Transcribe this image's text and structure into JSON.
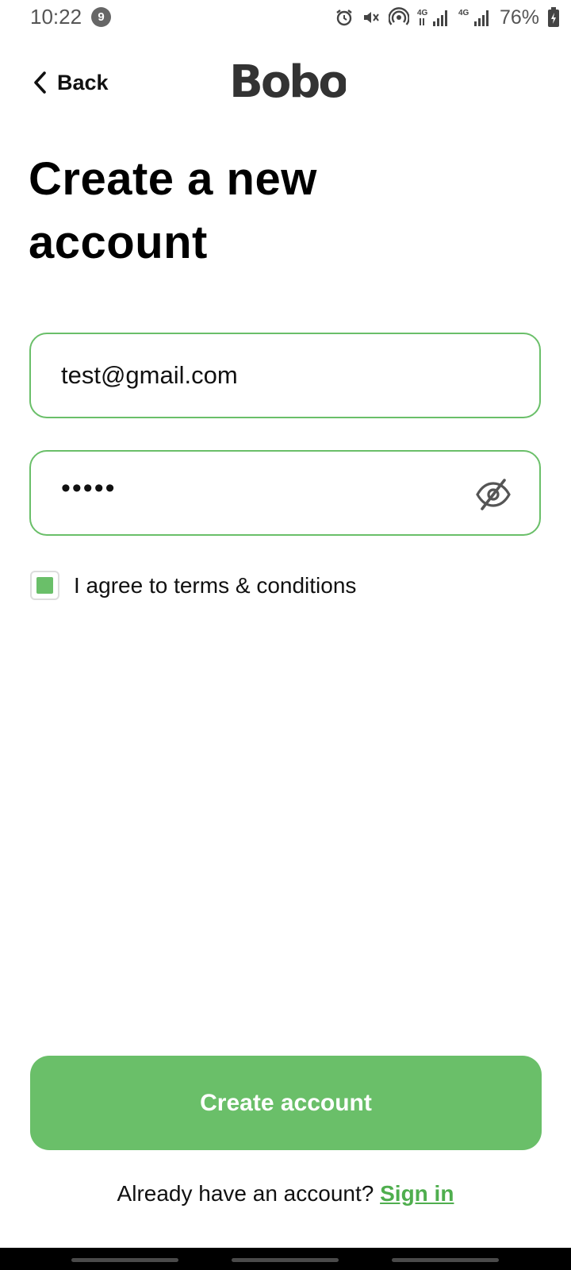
{
  "status_bar": {
    "time": "10:22",
    "notification_count": "9",
    "battery": "76%",
    "network_labels": [
      "4G",
      "4G"
    ],
    "icons": [
      "alarm-icon",
      "mute-icon",
      "hotspot-icon",
      "signal-icon",
      "battery-icon"
    ]
  },
  "header": {
    "back_label": "Back",
    "logo_text": "Bobo"
  },
  "title": {
    "line1": "Create a new",
    "line2": "account"
  },
  "form": {
    "email_value": "test@gmail.com",
    "password_value": "•••••",
    "terms_label": "I agree to terms & conditions",
    "terms_checked": true
  },
  "actions": {
    "create_label": "Create account",
    "signin_prompt": "Already have an account?",
    "signin_link": "Sign in"
  },
  "colors": {
    "accent": "#6abf69",
    "link": "#4fae4e",
    "logo": "#333333"
  }
}
